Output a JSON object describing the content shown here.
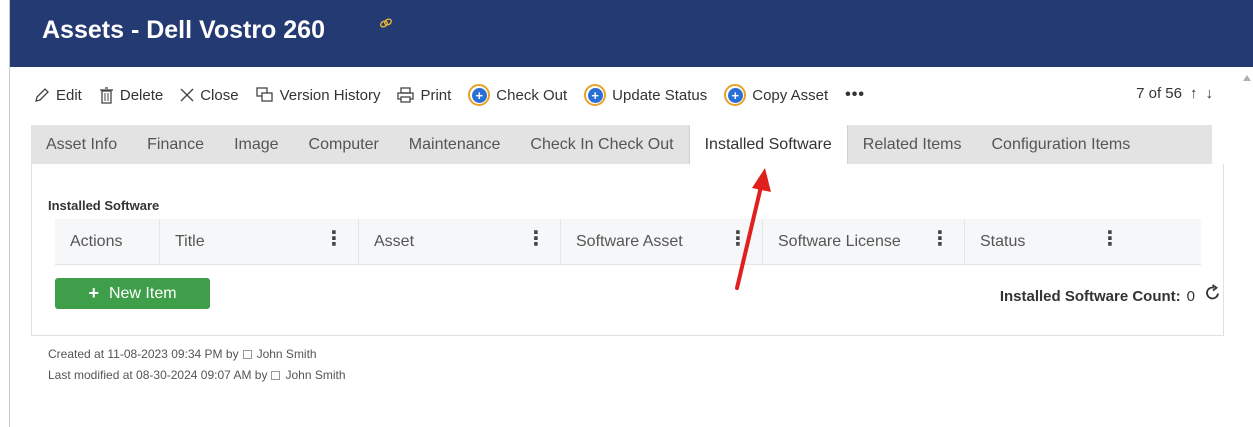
{
  "header": {
    "title": "Assets - Dell Vostro 260",
    "link_icon": "link-icon"
  },
  "toolbar": {
    "edit": "Edit",
    "delete": "Delete",
    "close": "Close",
    "version_history": "Version History",
    "print": "Print",
    "check_out": "Check Out",
    "update_status": "Update Status",
    "copy_asset": "Copy Asset",
    "more": "•••"
  },
  "pager": {
    "text": "7 of 56",
    "up": "↑",
    "down": "↓"
  },
  "tabs": [
    {
      "label": "Asset Info"
    },
    {
      "label": "Finance"
    },
    {
      "label": "Image"
    },
    {
      "label": "Computer"
    },
    {
      "label": "Maintenance"
    },
    {
      "label": "Check In Check Out"
    },
    {
      "label": "Installed Software",
      "active": true
    },
    {
      "label": "Related Items"
    },
    {
      "label": "Configuration Items"
    }
  ],
  "panel": {
    "section_label": "Installed Software",
    "columns": [
      "Actions",
      "Title",
      "Asset",
      "Software Asset",
      "Software License",
      "Status"
    ],
    "column_menu_glyph": "⋮",
    "new_item_label": "New Item",
    "new_item_plus": "+",
    "count_label": "Installed Software Count:",
    "count_value": "0"
  },
  "meta": {
    "created_prefix": "Created at 11-08-2023 09:34 PM by",
    "created_by": "John Smith",
    "modified_prefix": "Last modified at 08-30-2024 09:07 AM by",
    "modified_by": "John Smith"
  },
  "colors": {
    "header_bg": "#243a73",
    "new_button": "#3e9e4a",
    "annotation_arrow": "#e0201c",
    "action_icon_ring": "#e8a227",
    "action_icon_fill": "#2a6fd6"
  }
}
